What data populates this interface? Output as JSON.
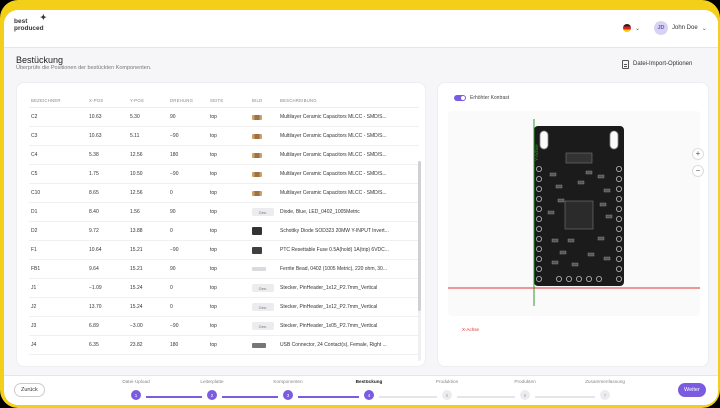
{
  "brand": {
    "line1": "best",
    "line2": "produced"
  },
  "header": {
    "user_initials": "JD",
    "user_name": "John Doe"
  },
  "page": {
    "title": "Bestückung",
    "subtitle": "Überprüfe die Positionen der bestückten Komponenten.",
    "import_button": "Datei-Import-Optionen"
  },
  "table": {
    "headers": [
      "Bezeichner",
      "X-Pos",
      "Y-Pos",
      "Drehung",
      "Seite",
      "Bild",
      "Beschreibung"
    ],
    "rows": [
      {
        "ref": "C2",
        "x": "10.63",
        "y": "5.30",
        "rot": "90",
        "side": "top",
        "img": "cap",
        "desc": "Multilayer Ceramic Capacitors MLCC - SMD/S..."
      },
      {
        "ref": "C3",
        "x": "10.63",
        "y": "5.11",
        "rot": "−90",
        "side": "top",
        "img": "cap",
        "desc": "Multilayer Ceramic Capacitors MLCC - SMD/S..."
      },
      {
        "ref": "C4",
        "x": "5.38",
        "y": "12.56",
        "rot": "180",
        "side": "top",
        "img": "cap",
        "desc": "Multilayer Ceramic Capacitors MLCC - SMD/S..."
      },
      {
        "ref": "C5",
        "x": "1.75",
        "y": "10.50",
        "rot": "−90",
        "side": "top",
        "img": "cap",
        "desc": "Multilayer Ceramic Capacitors MLCC - SMD/S..."
      },
      {
        "ref": "C10",
        "x": "8.65",
        "y": "12.56",
        "rot": "0",
        "side": "top",
        "img": "cap",
        "desc": "Multilayer Ceramic Capacitors MLCC - SMD/S..."
      },
      {
        "ref": "D1",
        "x": "8.40",
        "y": "1.56",
        "rot": "90",
        "side": "top",
        "img": "gen",
        "desc": "Diode, Blue, LED_0402_1005Metric"
      },
      {
        "ref": "D2",
        "x": "9.72",
        "y": "13.88",
        "rot": "0",
        "side": "top",
        "img": "chip",
        "desc": "Schottky Diode SOD323 20MW Y-INPUT Invert..."
      },
      {
        "ref": "F1",
        "x": "10.64",
        "y": "15.21",
        "rot": "−90",
        "side": "top",
        "img": "fuse",
        "desc": "PTC Resettable Fuse 0.5A(hold) 1A(trip) 6VDC..."
      },
      {
        "ref": "FB1",
        "x": "9.64",
        "y": "15.21",
        "rot": "90",
        "side": "top",
        "img": "bead",
        "desc": "Ferrite Bead, 0402 (1005 Metric), 220 ohm, 30..."
      },
      {
        "ref": "J1",
        "x": "−1.09",
        "y": "15.24",
        "rot": "0",
        "side": "top",
        "img": "gen",
        "desc": "Stecker, PinHeader_1x12_P2.7mm_Vertical"
      },
      {
        "ref": "J2",
        "x": "13.70",
        "y": "15.24",
        "rot": "0",
        "side": "top",
        "img": "gen",
        "desc": "Stecker, PinHeader_1x12_P2.7mm_Vertical"
      },
      {
        "ref": "J3",
        "x": "6.89",
        "y": "−3.00",
        "rot": "−90",
        "side": "top",
        "img": "gen",
        "desc": "Stecker, PinHeader_1x05_P2.7mm_Vertical"
      },
      {
        "ref": "J4",
        "x": "6.35",
        "y": "23.82",
        "rot": "180",
        "side": "top",
        "img": "usb",
        "desc": "USB Connector, 24 Contact(s), Female, Right ..."
      }
    ],
    "generic_label": "Gen."
  },
  "viewer": {
    "toggle_label": "Erhöhter Kontrast",
    "toggle_on": true,
    "y_axis_label": "Y-Achse",
    "x_axis_label": "X-Achse",
    "zoom_in": "+",
    "zoom_out": "−"
  },
  "footer": {
    "back": "Zurück",
    "next": "Weiter",
    "steps": [
      {
        "label": "Datei-Upload",
        "num": "1",
        "state": "done"
      },
      {
        "label": "Leiterplatte",
        "num": "2",
        "state": "done"
      },
      {
        "label": "Komponenten",
        "num": "3",
        "state": "done"
      },
      {
        "label": "Bestückung",
        "num": "4",
        "state": "active"
      },
      {
        "label": "Produktion",
        "num": "5",
        "state": "todo"
      },
      {
        "label": "Produkten",
        "num": "6",
        "state": "todo"
      },
      {
        "label": "Zusammenfassung",
        "num": "7",
        "state": "todo"
      }
    ]
  },
  "colors": {
    "accent": "#7b5ce0",
    "frame": "#f4cf1a",
    "y_axis": "#2a9a2a",
    "x_axis": "#dd3333"
  }
}
